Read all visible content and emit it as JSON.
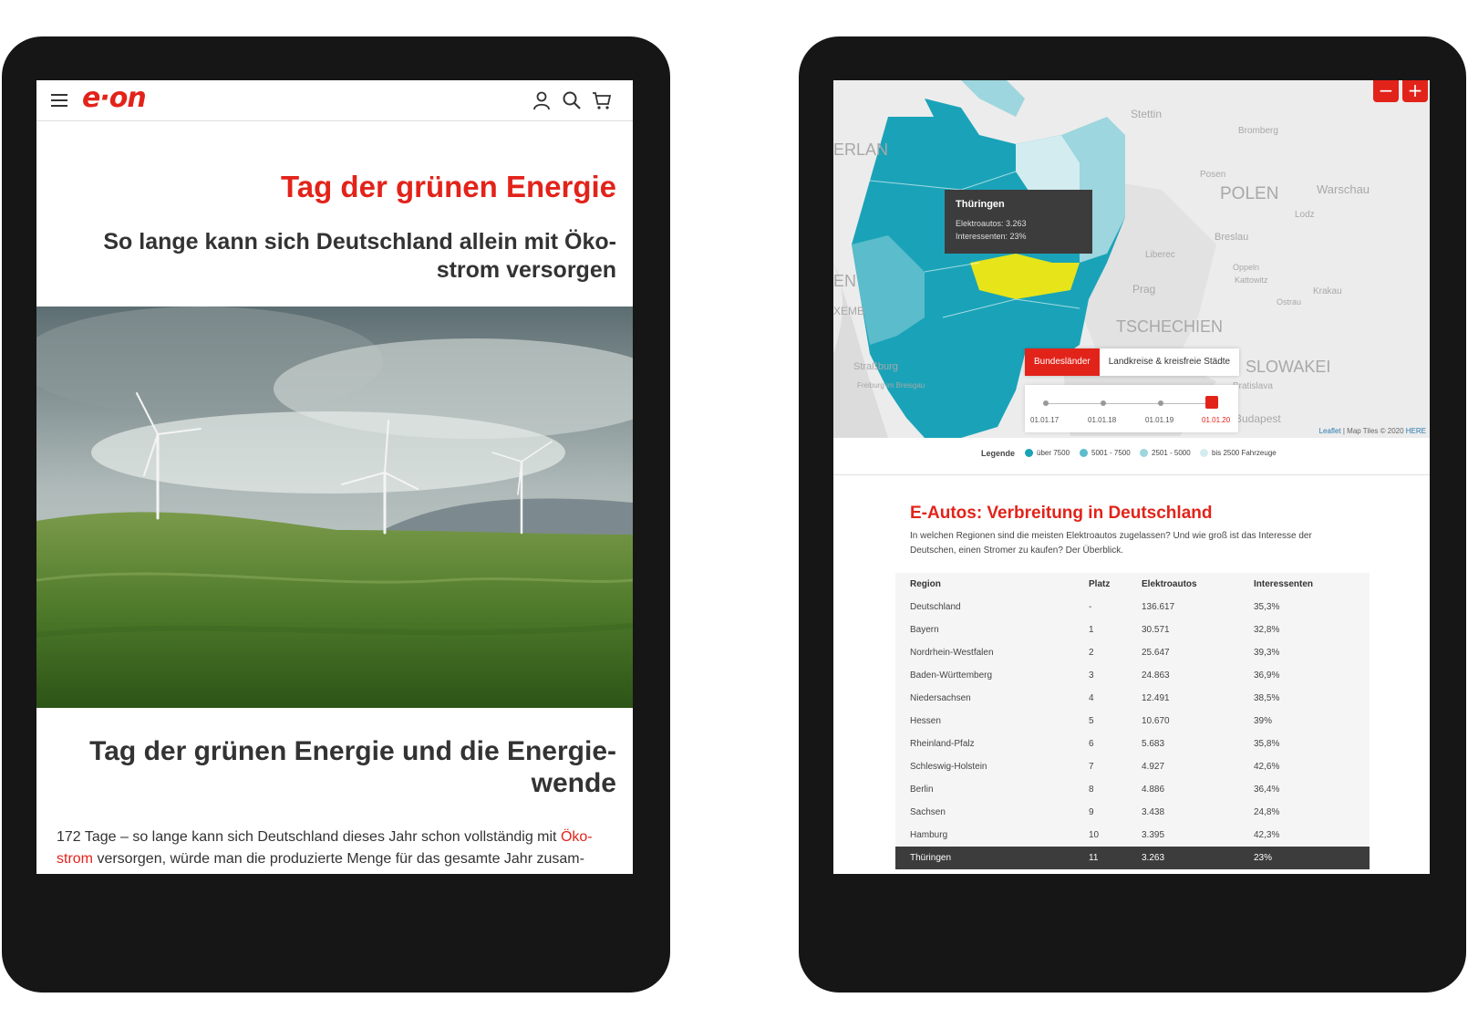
{
  "left": {
    "logo": "e·on",
    "title": "Tag der grünen Energie",
    "subtitle": "So lange kann sich Deutschland allein mit Öko-strom versorgen",
    "heading2": "Tag der grünen Energie und die Energie-wende",
    "body_pre": "172 Tage – so lange kann sich Deutschland dieses Jahr schon vollständig mit ",
    "body_link": "Öko-strom",
    "body_post": " versorgen, würde man die produzierte Menge für das gesamte Jahr zusam-"
  },
  "right": {
    "map": {
      "zoom_out": "−",
      "zoom_in": "+",
      "labels": {
        "stettin": "Stettin",
        "polen": "POLEN",
        "warschau": "Warschau",
        "breslau": "Breslau",
        "prag": "Prag",
        "tschechien": "TSCHECHIEN",
        "slowakei": "SLOWAKEI",
        "strassburg": "Straßburg",
        "budapest": "Budapest",
        "bromberg": "Bromberg",
        "liberec": "Liberec",
        "lodz": "Lodz",
        "posen": "Posen",
        "krakau": "Krakau",
        "oppeln": "Oppeln",
        "kattowitz": "Kattowitz",
        "bratislava": "Bratislava",
        "freiburg": "Freiburg im Breisgau",
        "ostrau": "Ostrau",
        "erlan": "ERLAN",
        "en": "EN",
        "xemb": "XEMB"
      },
      "tooltip": {
        "title": "Thüringen",
        "line1": "Elektroautos: 3.263",
        "line2": "Interessenten: 23%"
      },
      "tabs": [
        "Bundesländer",
        "Landkreise & kreisfreie Städte"
      ],
      "active_tab": "Bundesländer",
      "timeline": [
        "01.01.17",
        "01.01.18",
        "01.01.19",
        "01.01.20"
      ],
      "timeline_selected": "01.01.20",
      "attribution_link": "Leaflet",
      "attribution_text": " | Map Tiles © 2020 ",
      "attribution_here": "HERE"
    },
    "legend": {
      "title": "Legende",
      "items": [
        "über 7500",
        "5001 - 7500",
        "2501 - 5000",
        "bis 2500 Fahrzeuge"
      ],
      "colors": [
        "#1aa3b8",
        "#5bbccb",
        "#9dd6de",
        "#d3ecef"
      ]
    },
    "section_title": "E-Autos: Verbreitung in Deutschland",
    "section_desc": "In welchen Regionen sind die meisten Elektroautos zugelassen? Und wie groß ist das Interesse der Deutschen, einen Stromer zu kaufen? Der Überblick.",
    "table": {
      "headers": [
        "Region",
        "Platz",
        "Elektroautos",
        "Interessenten"
      ],
      "rows": [
        [
          "Deutschland",
          "-",
          "136.617",
          "35,3%"
        ],
        [
          "Bayern",
          "1",
          "30.571",
          "32,8%"
        ],
        [
          "Nordrhein-Westfalen",
          "2",
          "25.647",
          "39,3%"
        ],
        [
          "Baden-Württemberg",
          "3",
          "24.863",
          "36,9%"
        ],
        [
          "Niedersachsen",
          "4",
          "12.491",
          "38,5%"
        ],
        [
          "Hessen",
          "5",
          "10.670",
          "39%"
        ],
        [
          "Rheinland-Pfalz",
          "6",
          "5.683",
          "35,8%"
        ],
        [
          "Schleswig-Holstein",
          "7",
          "4.927",
          "42,6%"
        ],
        [
          "Berlin",
          "8",
          "4.886",
          "36,4%"
        ],
        [
          "Sachsen",
          "9",
          "3.438",
          "24,8%"
        ],
        [
          "Hamburg",
          "10",
          "3.395",
          "42,3%"
        ],
        [
          "Thüringen",
          "11",
          "3.263",
          "23%"
        ]
      ],
      "selected_row": "Thüringen"
    }
  },
  "colors": {
    "brand_red": "#e2231a",
    "teal_dark": "#1aa3b8",
    "highlight_yellow": "#e7e41a",
    "device_frame": "#161616"
  }
}
